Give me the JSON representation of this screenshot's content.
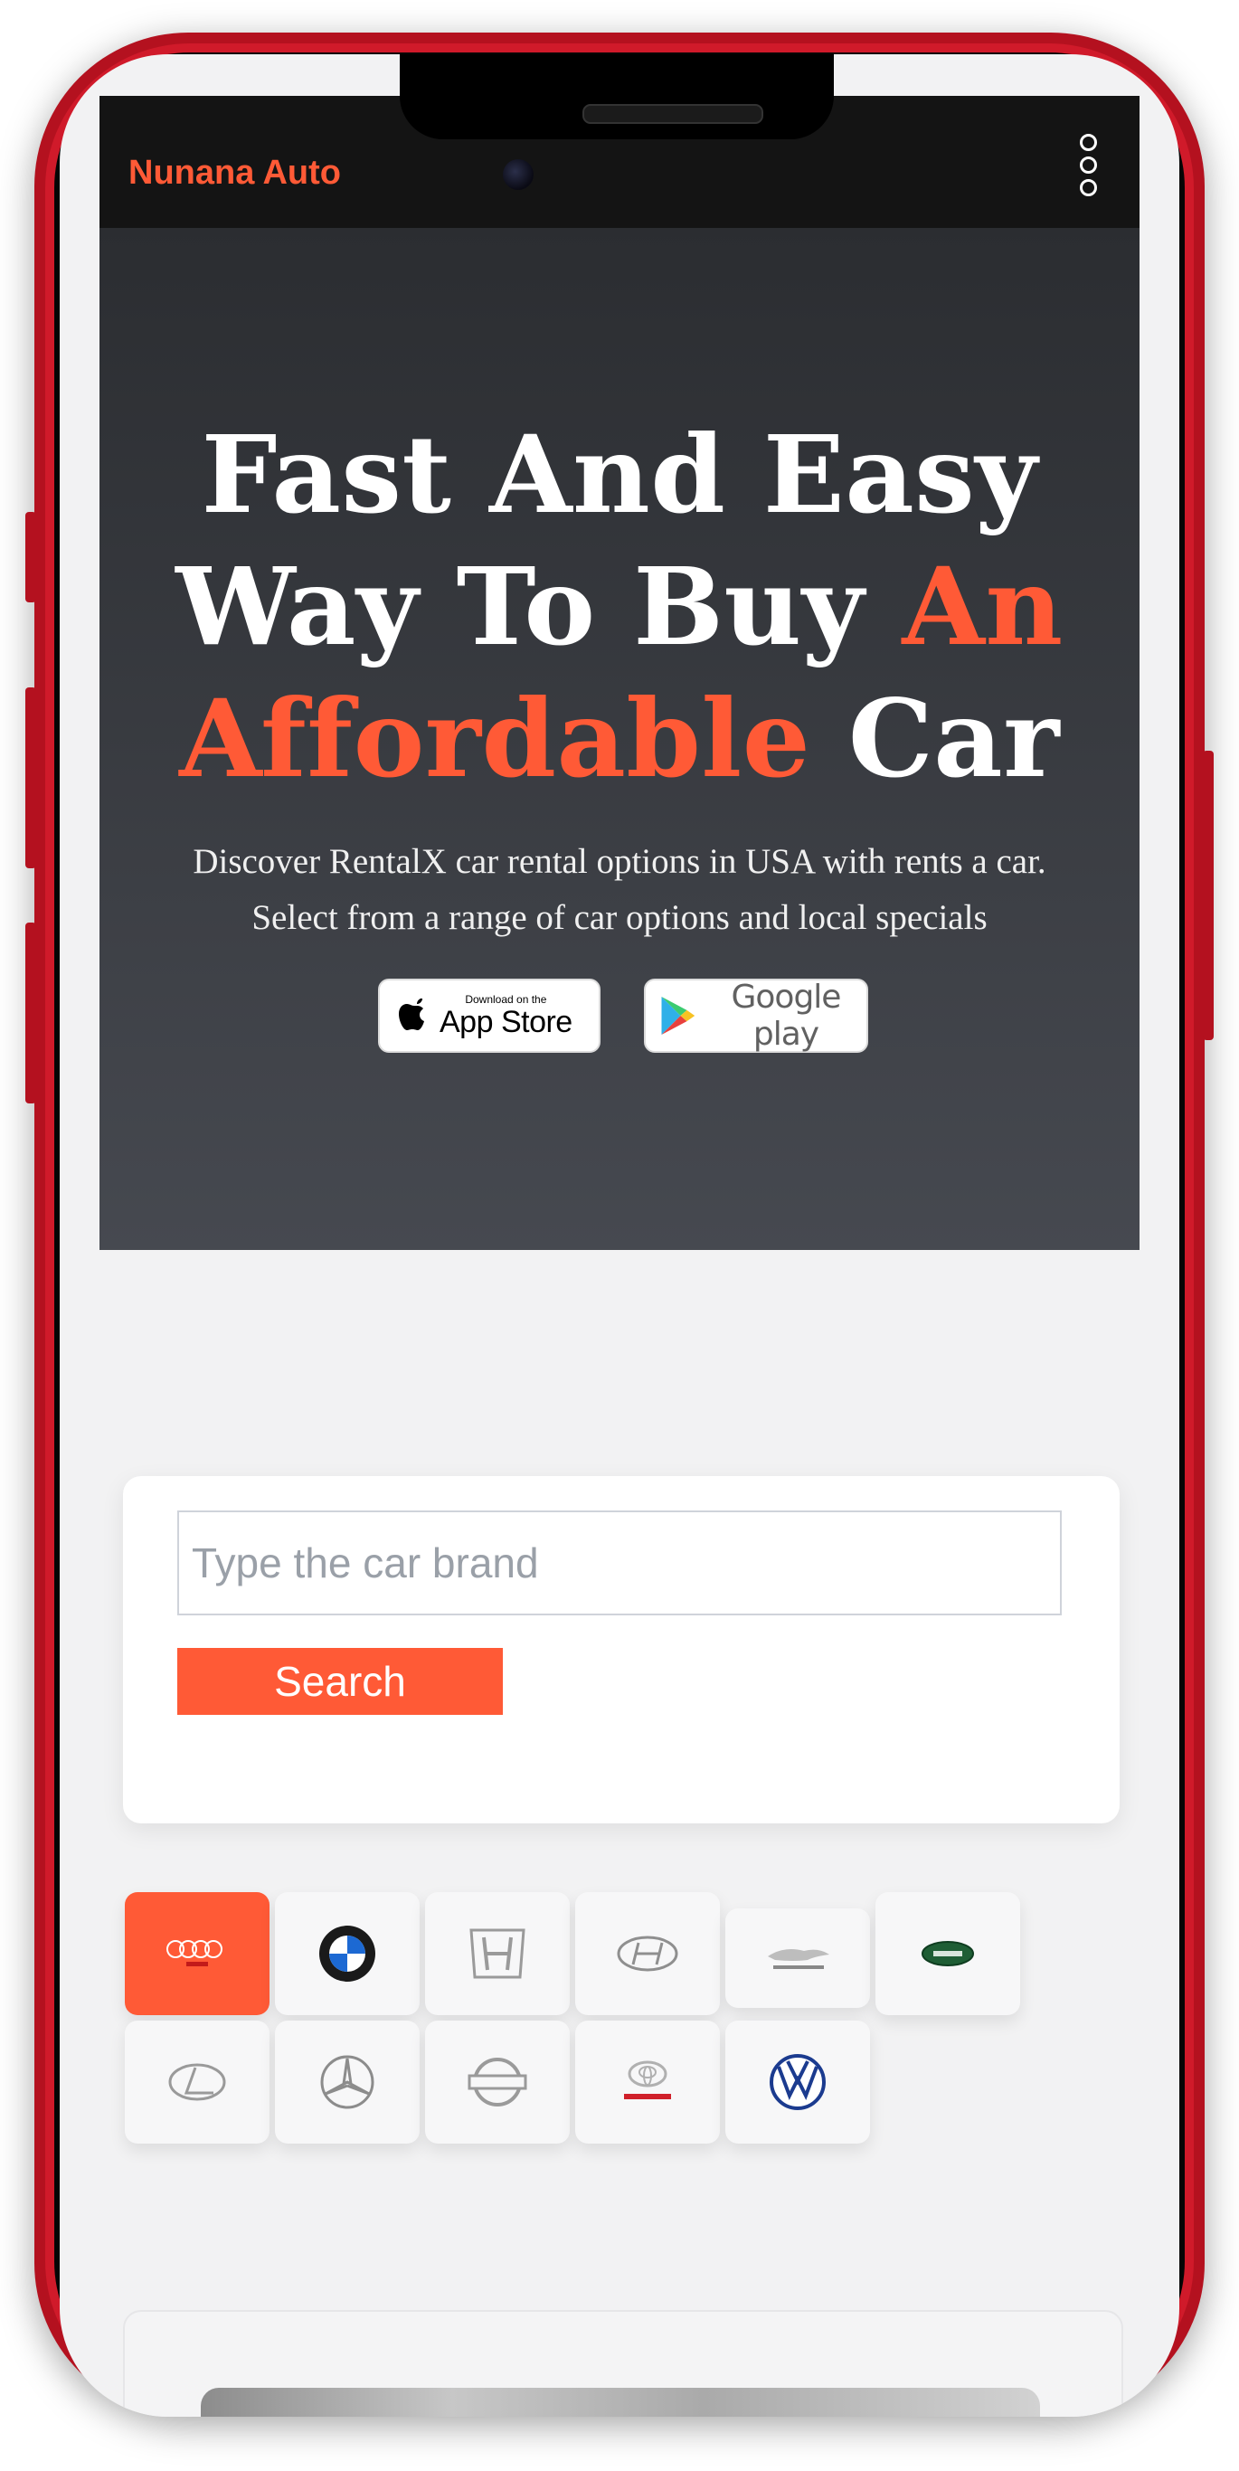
{
  "app": {
    "brand": "Nunana Auto"
  },
  "hero": {
    "title_line1": "Fast And Easy",
    "title_line2_white": "Way To Buy ",
    "title_line2_accent": "An",
    "title_line3_accent": "Affordable",
    "title_line3_white": " Car",
    "subtitle_line1": "Discover RentalX car rental options in USA with rents a car.",
    "subtitle_line2": "Select from a range of car options and local specials",
    "appstore_small": "Download on the",
    "appstore_big": "App Store",
    "googleplay": "Google play"
  },
  "search": {
    "placeholder": "Type the car brand",
    "button": "Search"
  },
  "brands": [
    {
      "name": "Audi",
      "icon": "audi-logo-icon",
      "active": true
    },
    {
      "name": "BMW",
      "icon": "bmw-logo-icon"
    },
    {
      "name": "Honda",
      "icon": "honda-logo-icon"
    },
    {
      "name": "Hyundai",
      "icon": "hyundai-logo-icon"
    },
    {
      "name": "Jaguar",
      "icon": "jaguar-logo-icon"
    },
    {
      "name": "Land Rover",
      "icon": "land-rover-logo-icon"
    },
    {
      "name": "Lexus",
      "icon": "lexus-logo-icon"
    },
    {
      "name": "Mercedes",
      "icon": "mercedes-logo-icon"
    },
    {
      "name": "Nissan",
      "icon": "nissan-logo-icon"
    },
    {
      "name": "Toyota",
      "icon": "toyota-logo-icon"
    },
    {
      "name": "Volkswagen",
      "icon": "volkswagen-logo-icon"
    }
  ],
  "colors": {
    "accent": "#ff5a36",
    "appbar": "#141414",
    "frame": "#b4111f"
  }
}
